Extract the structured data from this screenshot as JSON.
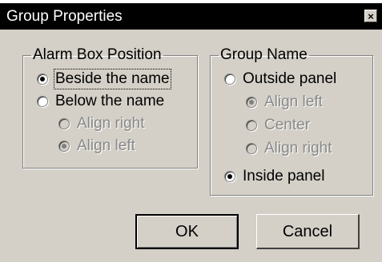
{
  "window": {
    "title": "Group Properties",
    "close_glyph": "×"
  },
  "alarm_box": {
    "title": "Alarm Box Position",
    "options": [
      {
        "label": "Beside the name",
        "checked": true,
        "enabled": true
      },
      {
        "label": "Below the name",
        "checked": false,
        "enabled": true
      }
    ],
    "sub_options": [
      {
        "label": "Align right",
        "checked": false,
        "enabled": false
      },
      {
        "label": "Align left",
        "checked": true,
        "enabled": false
      }
    ]
  },
  "group_name": {
    "title": "Group Name",
    "outside_label": "Outside panel",
    "outside_checked": false,
    "sub_options": [
      {
        "label": "Align left",
        "checked": true,
        "enabled": false
      },
      {
        "label": "Center",
        "checked": false,
        "enabled": false
      },
      {
        "label": "Align right",
        "checked": false,
        "enabled": false
      }
    ],
    "inside_label": "Inside panel",
    "inside_checked": true
  },
  "buttons": {
    "ok_label": "OK",
    "cancel_label": "Cancel"
  }
}
